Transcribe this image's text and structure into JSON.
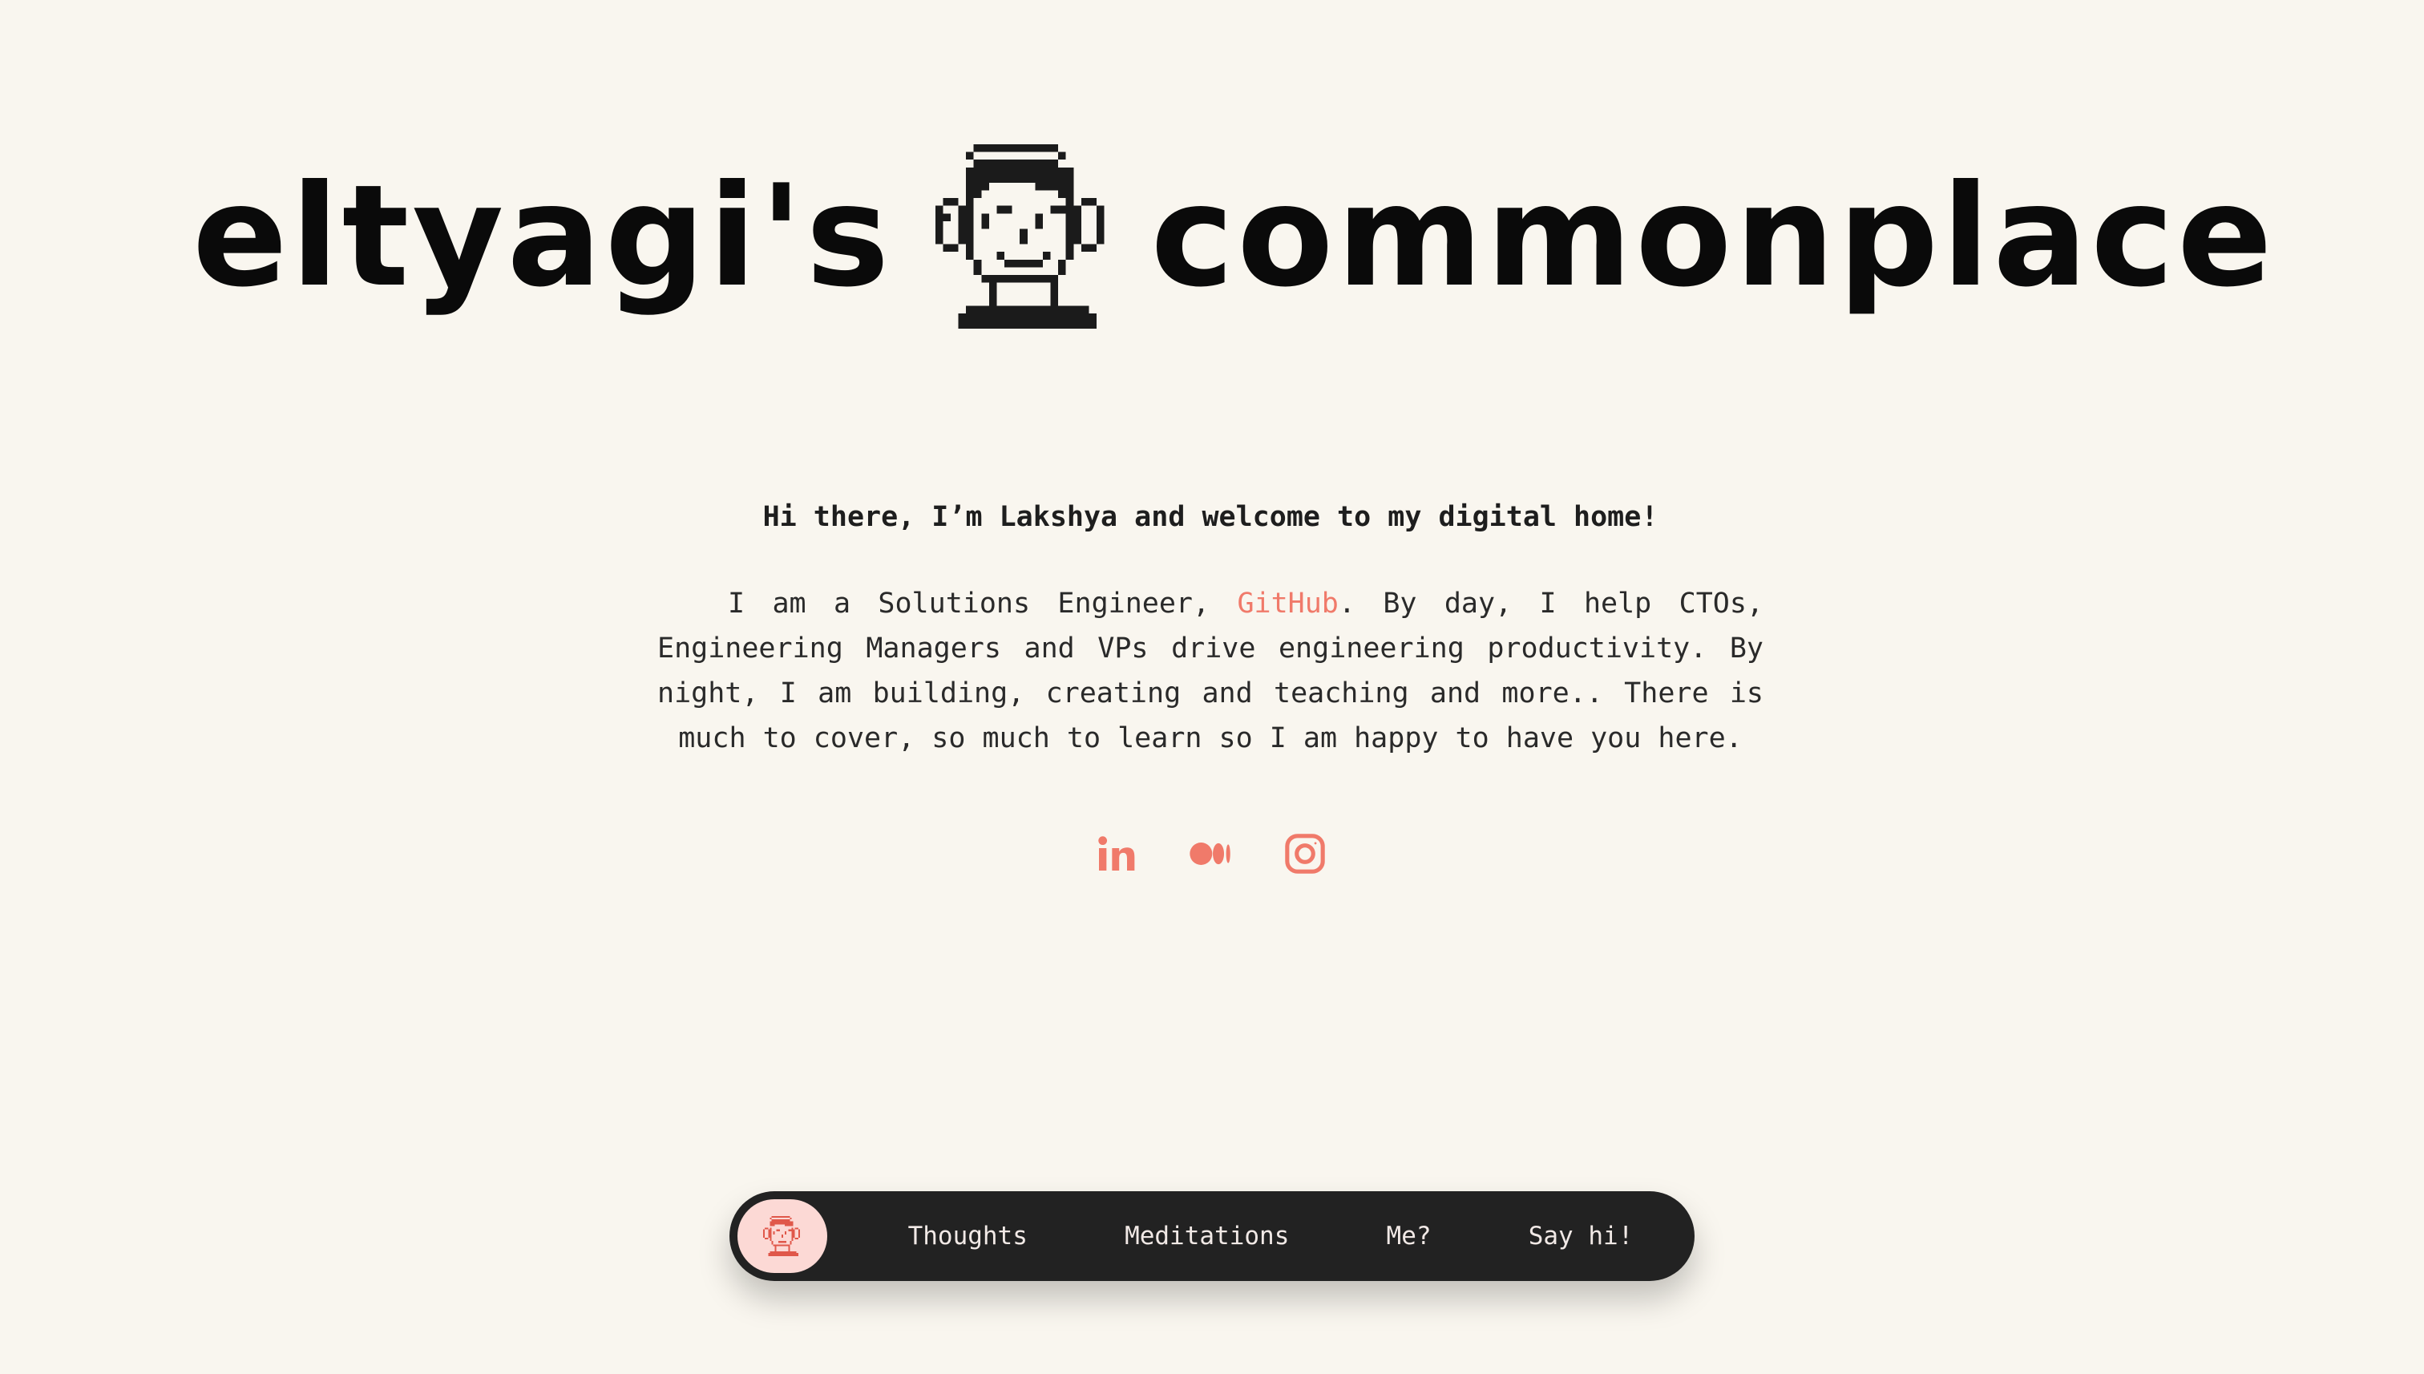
{
  "hero": {
    "title_left": "eltyagi's",
    "title_right": "commonplace",
    "avatar_icon": "pixel-avatar-icon"
  },
  "intro": {
    "greeting": "Hi there, I’m Lakshya and welcome to my digital home!",
    "bio_before_link": "I am a Solutions Engineer, ",
    "bio_link": "GitHub",
    "bio_after_link": ". By day, I help CTOs, Engineering Managers and VPs drive engineering productivity. By night, I am building, creating and teaching and more.. There is much to cover, so much to learn so I am happy to have you here."
  },
  "socials": [
    {
      "icon": "linkedin-icon"
    },
    {
      "icon": "medium-icon"
    },
    {
      "icon": "instagram-icon"
    }
  ],
  "nav": {
    "home_icon": "avatar-home-icon",
    "items": [
      {
        "label": "Thoughts"
      },
      {
        "label": "Meditations"
      },
      {
        "label": "Me?"
      },
      {
        "label": "Say hi!"
      }
    ]
  },
  "colors": {
    "background": "#f9f6ef",
    "accent": "#f07a6a",
    "nav_bg": "#222222",
    "nav_home_bg": "#fcd9d5",
    "text": "#2a2a2a"
  }
}
